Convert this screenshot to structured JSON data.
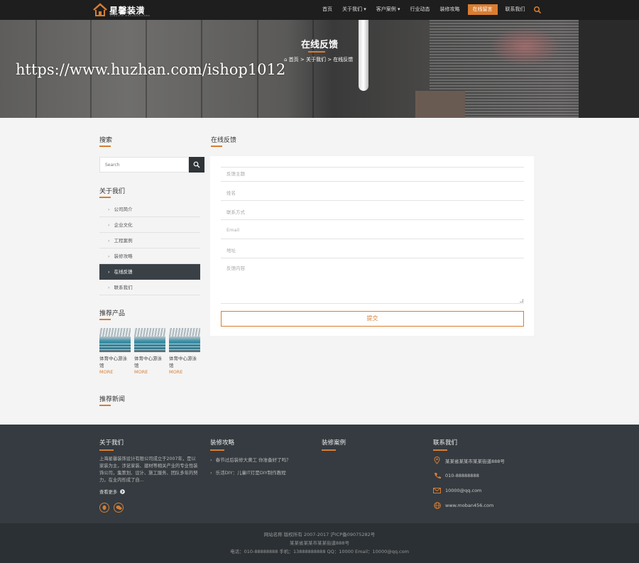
{
  "header": {
    "logo_text": "星馨装潢",
    "logo_sub": "XINGXIN ZHUANGHUANG",
    "nav": [
      {
        "label": "首页"
      },
      {
        "label": "关于我们 ▾"
      },
      {
        "label": "客户案例 ▾"
      },
      {
        "label": "行业动态"
      },
      {
        "label": "装修攻略"
      },
      {
        "label": "在线留言"
      },
      {
        "label": "联系我们"
      }
    ],
    "active_nav": "在线留言",
    "accent": "#d87d32"
  },
  "banner": {
    "title": "在线反馈",
    "breadcrumb": "首页 > 关于我们 > 在线反馈",
    "watermark": "https://www.huzhan.com/ishop1012"
  },
  "sidebar": {
    "search_title": "搜索",
    "search_placeholder": "Search",
    "about_title": "关于我们",
    "menu": [
      {
        "label": "公司简介"
      },
      {
        "label": "企业文化"
      },
      {
        "label": "工程案例"
      },
      {
        "label": "装修攻略"
      },
      {
        "label": "在线反馈"
      },
      {
        "label": "联系我们"
      }
    ],
    "active_item": "在线反馈",
    "products_title": "推荐产品",
    "products": [
      {
        "name": "体育中心游泳馆",
        "more": "MORE"
      },
      {
        "name": "体育中心游泳馆",
        "more": "MORE"
      },
      {
        "name": "体育中心游泳馆",
        "more": "MORE"
      }
    ],
    "news_title": "推荐新闻"
  },
  "main": {
    "title": "在线反馈",
    "fields": [
      {
        "placeholder": "反馈主题"
      },
      {
        "placeholder": "姓名"
      },
      {
        "placeholder": "联系方式"
      },
      {
        "placeholder": "Email"
      },
      {
        "placeholder": "地址"
      }
    ],
    "content_placeholder": "反馈内容",
    "submit_label": "提交"
  },
  "footer": {
    "about_title": "关于我们",
    "about_text": "上海星馨装饰设计有限公司成立于2007年，是以家装为主，涉足家装、建材等相关产业的专业性装饰公司，集策划、设计、施工服务、团队多年的努力，在业内形成了自...",
    "more_label": "查看更多",
    "strategy_title": "装修攻略",
    "strategy_items": [
      {
        "text": "春节过后装修大黄工 你准备好了吗？"
      },
      {
        "text": "乐活DIY：儿童IT灯是DIY制作教程"
      }
    ],
    "cases_title": "装修案例",
    "contact_title": "联系我们",
    "contacts": [
      {
        "icon": "location-icon",
        "text": "某某省某某市某某街道888号"
      },
      {
        "icon": "phone-icon",
        "text": "010-88888888"
      },
      {
        "icon": "mail-icon",
        "text": "10000@qq.com"
      },
      {
        "icon": "globe-icon",
        "text": "www.moban456.com"
      }
    ]
  },
  "copyright": {
    "line1": "网站名称 版权所有 2007-2017 沪ICP备09075282号",
    "line2": "某某省某某市某某街道888号",
    "line3": "电话：010-88888888 手机：13888888888 QQ：10000 Email：10000@qq.com"
  }
}
